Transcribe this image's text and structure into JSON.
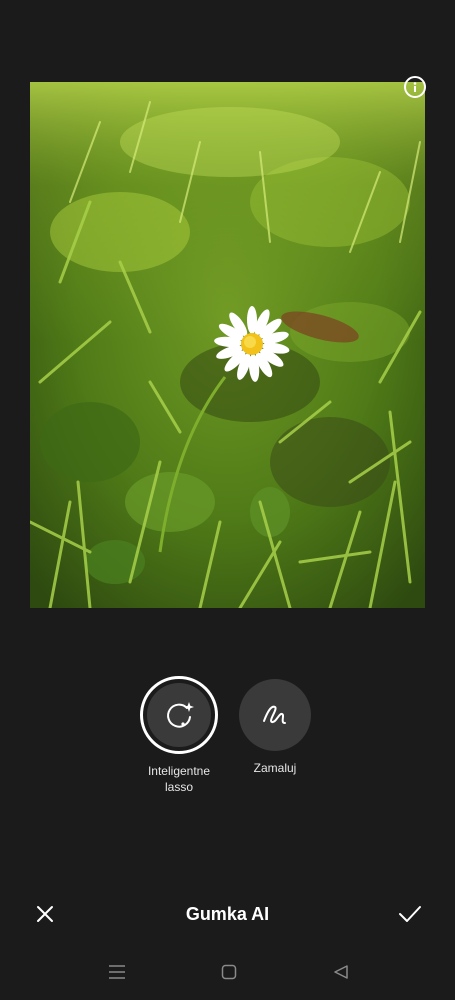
{
  "image": {
    "description_icon": "info-icon"
  },
  "tools": [
    {
      "label": "Inteligentne\nlasso",
      "icon": "smart-lasso-icon",
      "selected": true
    },
    {
      "label": "Zamaluj",
      "icon": "brush-stroke-icon",
      "selected": false
    }
  ],
  "bottom_bar": {
    "title": "Gumka AI",
    "cancel_icon": "close-icon",
    "confirm_icon": "checkmark-icon"
  },
  "navigation": {
    "menu_icon": "menu-icon",
    "home_icon": "home-icon",
    "back_icon": "back-icon"
  },
  "colors": {
    "background": "#1b1b1b",
    "tool_circle": "#3a3a3a",
    "text": "#ffffff"
  }
}
